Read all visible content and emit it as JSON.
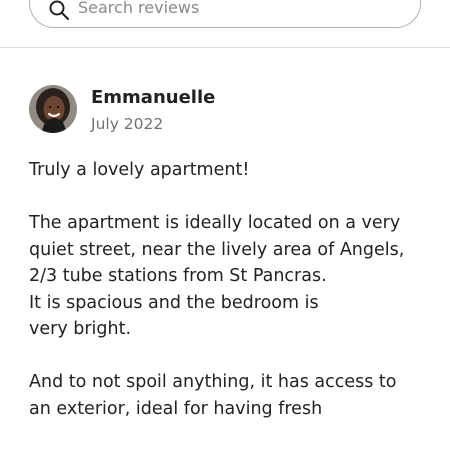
{
  "search": {
    "placeholder": "Search reviews",
    "icon": "search-icon"
  },
  "review": {
    "reviewer_name": "Emmanuelle",
    "date": "July 2022",
    "avatar": "reviewer-photo",
    "paragraphs": [
      [
        "Truly a lovely apartment!"
      ],
      [
        "The apartment is ideally located on a very",
        "quiet street, near the lively area of Angels,",
        "2/3 tube stations from St Pancras.",
        "It is spacious and the bedroom is",
        "very bright."
      ],
      [
        "And to not spoil anything, it has access to",
        "an exterior, ideal for having fresh"
      ]
    ]
  },
  "colors": {
    "text": "#222222",
    "secondary_text": "#717171",
    "border": "#b0b0b0",
    "divider": "#dddddd"
  }
}
